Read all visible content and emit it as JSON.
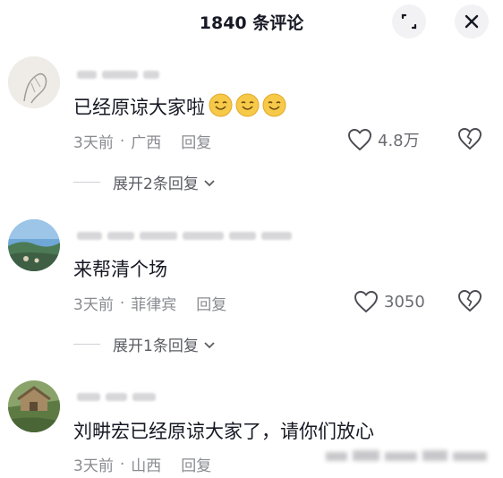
{
  "header": {
    "title": "1840 条评论",
    "expand_icon": "expand-icon",
    "close_icon": "close-icon"
  },
  "comments": [
    {
      "text": "已经原谅大家啦",
      "emoji": [
        "smile-emoji",
        "smile-emoji",
        "smile-emoji"
      ],
      "time": "3天前",
      "location": "广西",
      "reply_label": "回复",
      "likes": "4.8万",
      "expand_label": "展开2条回复"
    },
    {
      "text": "来帮清个场",
      "time": "3天前",
      "location": "菲律宾",
      "reply_label": "回复",
      "likes": "3050",
      "expand_label": "展开1条回复"
    },
    {
      "text": "刘畊宏已经原谅大家了，请你们放心",
      "time": "3天前",
      "location": "山西",
      "reply_label": "回复"
    }
  ],
  "colors": {
    "primary_text": "#161823",
    "secondary_text": "#8a8b91",
    "button_bg": "#f2f2f4",
    "emoji_yellow": "#f7c948"
  }
}
